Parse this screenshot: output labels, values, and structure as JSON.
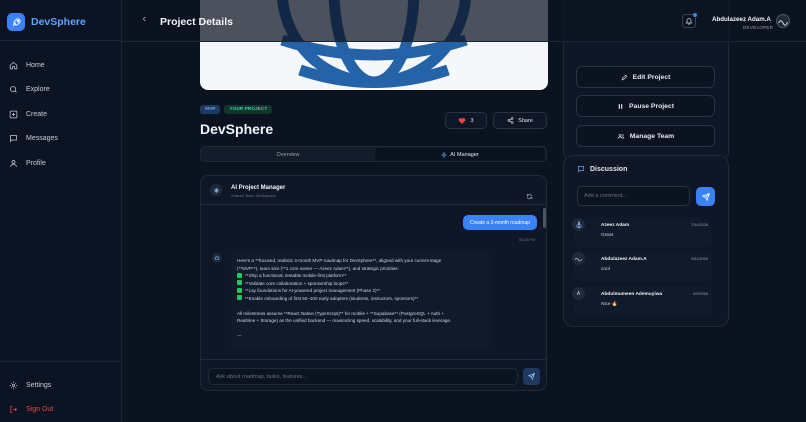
{
  "brand": {
    "name": "DevSphere",
    "accent": "#3b82f6"
  },
  "sidebar": {
    "items": [
      {
        "label": "Home",
        "icon": "home-icon"
      },
      {
        "label": "Explore",
        "icon": "search-icon"
      },
      {
        "label": "Create",
        "icon": "plus-square-icon"
      },
      {
        "label": "Messages",
        "icon": "message-icon"
      },
      {
        "label": "Profile",
        "icon": "user-icon"
      }
    ],
    "settings_label": "Settings",
    "signout_label": "Sign Out"
  },
  "header": {
    "title": "Project Details",
    "user_name": "Abdulazeez Adam.A",
    "user_role": "DEVELOPER"
  },
  "project": {
    "badges": [
      "MVP",
      "YOUR PROJECT"
    ],
    "name": "DevSphere",
    "likes": "3",
    "share_label": "Share"
  },
  "tabs": [
    {
      "label": "Overview",
      "active": false
    },
    {
      "label": "AI Manager",
      "active": true
    }
  ],
  "ai_manager": {
    "title": "AI Project Manager",
    "subtitle": "Shared Team Workspace",
    "user_message": "Create a 3-month roadmap",
    "user_message_time": "05:28 PM",
    "bot_lines": [
      "Here's a **focused, realistic 3-month MVP roadmap for DevSphere**, aligned with your current stage",
      "(**MVP**), team size (**1 core owner — Azeez Adam**), and strategic priorities:",
      "**Ship a functional, testable mobile-first platform**",
      "**Validate core collaboration + sponsorship loops**",
      "**Lay foundations for AI-powered project management (Phase 2)**",
      "**Enable onboarding of first 50–100 early adopters (students, instructors, sponsors)**",
      "All milestones assume **React Native (TypeScript)** for mobile + **Supabase** (PostgreSQL + Auth +",
      "Realtime + Storage) as the unified backend — maximizing speed, scalability, and your full-stack leverage.",
      "---"
    ],
    "input_placeholder": "Ask about roadmap, tasks, features..."
  },
  "actions": [
    {
      "label": "Edit Project",
      "icon": "edit-icon"
    },
    {
      "label": "Pause Project",
      "icon": "pause-icon"
    },
    {
      "label": "Manage Team",
      "icon": "users-icon"
    }
  ],
  "discussion": {
    "title": "Discussion",
    "input_placeholder": "Add a comment...",
    "comments": [
      {
        "author": "Azeez Adam",
        "date": "7/14/2026",
        "text": "Great",
        "avatar": "anchor-icon"
      },
      {
        "author": "Abdulazeez Adam.A",
        "date": "5/11/2026",
        "text": "cool",
        "avatar": "wave-logo-icon"
      },
      {
        "author": "Abdulmumeen Ademuyiwa",
        "date": "5/9/2026",
        "text": "Nice 🔥",
        "avatar_letter": "A"
      }
    ]
  }
}
